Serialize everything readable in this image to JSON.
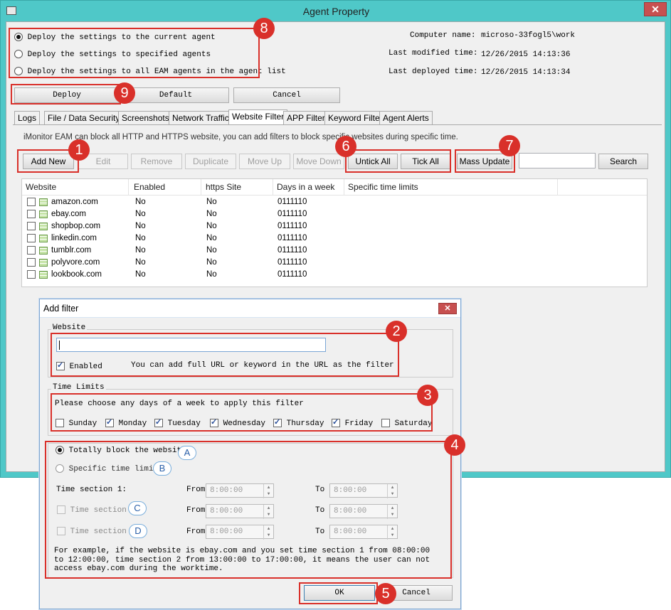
{
  "window": {
    "title": "Agent Property"
  },
  "deploy_options": [
    {
      "label": "Deploy the settings to the current agent",
      "selected": true
    },
    {
      "label": "Deploy the settings to specified agents",
      "selected": false
    },
    {
      "label": "Deploy the settings to all EAM agents in the agent list",
      "selected": false
    }
  ],
  "info": {
    "computer_name_label": "Computer name:",
    "computer_name": "microso-33fogl5\\work",
    "last_modified_label": "Last modified time:",
    "last_modified": "12/26/2015 14:13:36",
    "last_deployed_label": "Last deployed time:",
    "last_deployed": "12/26/2015 14:13:34"
  },
  "actions": {
    "deploy": "Deploy",
    "default": "Default",
    "cancel": "Cancel"
  },
  "tabs": [
    "Logs",
    "File / Data Security",
    "Screenshots",
    "Network Traffic",
    "Website Filter",
    "APP Filter",
    "Keyword Filter",
    "Agent Alerts"
  ],
  "active_tab": "Website Filter",
  "description": "iMonitor EAM can block all HTTP and HTTPS website, you can add filters to block specific websites during specific time.",
  "toolbar": {
    "add_new": "Add New",
    "edit": "Edit",
    "remove": "Remove",
    "duplicate": "Duplicate",
    "move_up": "Move Up",
    "move_down": "Move Down",
    "untick_all": "Untick All",
    "tick_all": "Tick All",
    "mass_update": "Mass Update",
    "search": "Search",
    "search_value": ""
  },
  "table": {
    "columns": [
      "Website",
      "Enabled",
      "https Site",
      "Days in a week",
      "Specific time limits"
    ],
    "rows": [
      [
        "amazon.com",
        "No",
        "No",
        "0111110",
        ""
      ],
      [
        "ebay.com",
        "No",
        "No",
        "0111110",
        ""
      ],
      [
        "shopbop.com",
        "No",
        "No",
        "0111110",
        ""
      ],
      [
        "linkedin.com",
        "No",
        "No",
        "0111110",
        ""
      ],
      [
        "tumblr.com",
        "No",
        "No",
        "0111110",
        ""
      ],
      [
        "polyvore.com",
        "No",
        "No",
        "0111110",
        ""
      ],
      [
        "lookbook.com",
        "No",
        "No",
        "0111110",
        ""
      ]
    ]
  },
  "dialog": {
    "title": "Add filter",
    "website_group": "Website",
    "website_value": "",
    "enabled_label": "Enabled",
    "enabled": true,
    "website_hint": "You can add full URL or keyword in the URL as the filter",
    "time_group": "Time Limits",
    "days_prompt": "Please choose any days of a week to apply this filter",
    "days": [
      {
        "label": "Sunday",
        "checked": false
      },
      {
        "label": "Monday",
        "checked": true
      },
      {
        "label": "Tuesday",
        "checked": true
      },
      {
        "label": "Wednesday",
        "checked": true
      },
      {
        "label": "Thursday",
        "checked": true
      },
      {
        "label": "Friday",
        "checked": true
      },
      {
        "label": "Saturday",
        "checked": false
      }
    ],
    "totally_block": "Totally block the website",
    "specific_limits": "Specific time limits",
    "sections": [
      {
        "label": "Time section 1:",
        "from_label": "From",
        "from": "8:00:00",
        "to_label": "To",
        "to": "8:00:00"
      },
      {
        "label": "Time section 2",
        "from_label": "From",
        "from": "8:00:00",
        "to_label": "To",
        "to": "8:00:00"
      },
      {
        "label": "Time section 3",
        "from_label": "From",
        "from": "8:00:00",
        "to_label": "To",
        "to": "8:00:00"
      }
    ],
    "example": "For example, if the website is ebay.com and you set  time section 1 from 08:00:00 to 12:00:00, time section 2 from 13:00:00 to 17:00:00, it means the user can not access ebay.com during the worktime.",
    "ok": "OK",
    "cancel": "Cancel"
  },
  "callouts": {
    "badges": [
      "1",
      "2",
      "3",
      "4",
      "5",
      "6",
      "7",
      "8",
      "9"
    ],
    "letters": [
      "A",
      "B",
      "C",
      "D"
    ]
  }
}
